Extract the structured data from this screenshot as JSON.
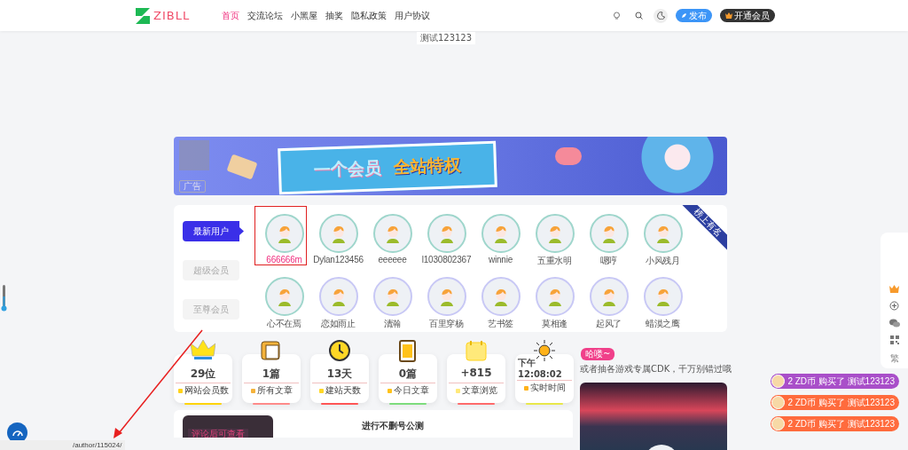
{
  "header": {
    "logo": "ZIBLL",
    "nav": [
      {
        "label": "首页",
        "selected": true
      },
      {
        "label": "交流论坛",
        "selected": false
      },
      {
        "label": "小黑屋",
        "selected": false
      },
      {
        "label": "抽奖",
        "selected": false
      },
      {
        "label": "隐私政策",
        "selected": false
      },
      {
        "label": "用户协议",
        "selected": false
      }
    ],
    "publish_button": "发布",
    "vip_button": "开通会员"
  },
  "notice": "测试123123",
  "banner": {
    "headline": "一个会员",
    "slogan": "全站特权",
    "ad_tag": "广告"
  },
  "users": {
    "ribbon": "榜上有名",
    "tabs": [
      {
        "label": "最新用户",
        "selected": true
      },
      {
        "label": "超级会员",
        "selected": false
      },
      {
        "label": "至尊会员",
        "selected": false
      }
    ],
    "items": [
      {
        "name": "666666m",
        "selected": true,
        "color": "#9fd6cc"
      },
      {
        "name": "Dylan123456",
        "selected": false,
        "color": "#9fd6cc"
      },
      {
        "name": "eeeeee",
        "selected": false,
        "color": "#9fd6cc"
      },
      {
        "name": "l1030802367",
        "selected": false,
        "color": "#9fd6cc"
      },
      {
        "name": "winnie",
        "selected": false,
        "color": "#9fd6cc"
      },
      {
        "name": "五重水明",
        "selected": false,
        "color": "#9fd6cc"
      },
      {
        "name": "嗯哼",
        "selected": false,
        "color": "#9fd6cc"
      },
      {
        "name": "小风残月",
        "selected": false,
        "color": "#9fd6cc"
      },
      {
        "name": "心不在焉",
        "selected": false,
        "color": "#9fd6cc"
      },
      {
        "name": "恋如雨止",
        "selected": false,
        "color": "#c8c8f5"
      },
      {
        "name": "清瀚",
        "selected": false,
        "color": "#c8c8f5"
      },
      {
        "name": "百里穿杨",
        "selected": false,
        "color": "#c8c8f5"
      },
      {
        "name": "艺书签",
        "selected": false,
        "color": "#c8c8f5"
      },
      {
        "name": "莫相逢",
        "selected": false,
        "color": "#c8c8f5"
      },
      {
        "name": "起风了",
        "selected": false,
        "color": "#c8c8f5"
      },
      {
        "name": "蜡漠之鹰",
        "selected": false,
        "color": "#c8c8f5"
      }
    ]
  },
  "stats": [
    {
      "kind": "crown",
      "value": "29位",
      "label": "网站会员数",
      "color": "#ffd400"
    },
    {
      "kind": "book",
      "value": "1篇",
      "label": "所有文章",
      "color": "#ff8a8a"
    },
    {
      "kind": "clock",
      "value": "13天",
      "label": "建站天数",
      "color": "#ff5555"
    },
    {
      "kind": "clipboard",
      "value": "0篇",
      "label": "今日文章",
      "color": "#7ddc7d"
    },
    {
      "kind": "calendar",
      "value": "+815",
      "label": "文章浏览",
      "color": "#ff6b6b"
    },
    {
      "kind": "sun",
      "value": "下午 12:08:02",
      "label": "实时时间",
      "color": "#e8e84a"
    }
  ],
  "post": {
    "cover_text": "评论后可查看",
    "title": "进行不删号公测"
  },
  "side": {
    "badge": "哈喽~",
    "marquee": "或者抽各游戏专属CDK，千万别错过哦"
  },
  "toolbar": {
    "traditional": "繁"
  },
  "purchases": [
    {
      "text": "2 ZD币 购买了 测试123123",
      "color": "#a94fc9"
    },
    {
      "text": "2 ZD币 购买了 测试123123",
      "color": "#ff6b3d"
    },
    {
      "text": "2 ZD币 购买了 测试123123",
      "color": "#ff6b3d"
    }
  ],
  "status_url": "/author/115024/"
}
